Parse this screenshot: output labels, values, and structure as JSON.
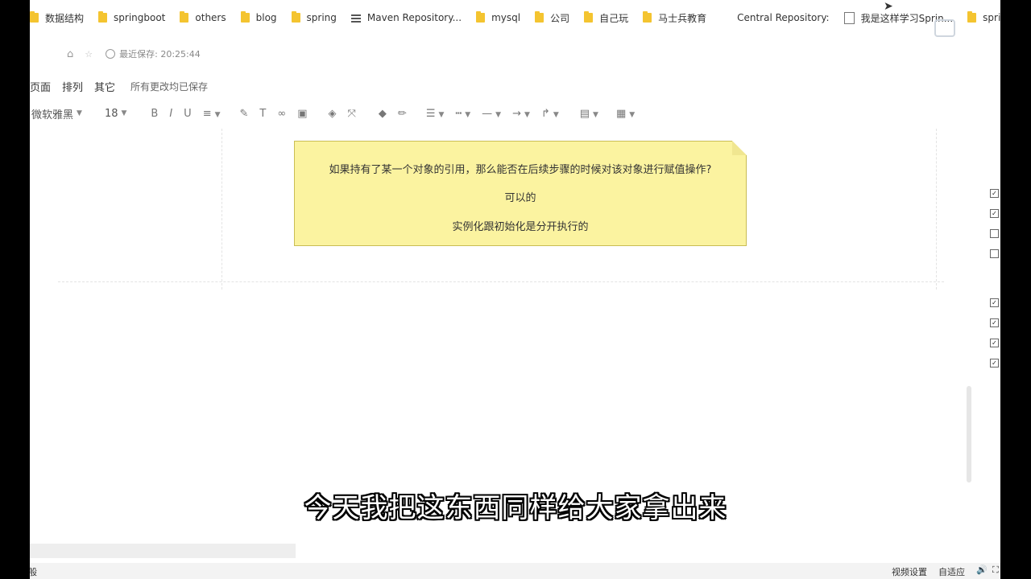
{
  "bookmarks": [
    {
      "label": "数据结构",
      "icon": "folder-icon"
    },
    {
      "label": "springboot",
      "icon": "folder-icon"
    },
    {
      "label": "others",
      "icon": "folder-icon"
    },
    {
      "label": "blog",
      "icon": "folder-icon"
    },
    {
      "label": "spring",
      "icon": "folder-icon"
    },
    {
      "label": "Maven Repository...",
      "icon": "maven-icon"
    },
    {
      "label": "mysql",
      "icon": "folder-icon"
    },
    {
      "label": "公司",
      "icon": "folder-icon"
    },
    {
      "label": "自己玩",
      "icon": "folder-icon"
    },
    {
      "label": "马士兵教育",
      "icon": "folder-icon"
    },
    {
      "label": "Central Repository:",
      "icon": ""
    },
    {
      "label": "我是这样学习Sprin...",
      "icon": "page-icon"
    },
    {
      "label": "sprin",
      "icon": "folder-icon"
    }
  ],
  "header": {
    "saved_time": "最近保存: 20:25:44"
  },
  "menu": {
    "items": [
      "页面",
      "排列",
      "其它"
    ],
    "status": "所有更改均已保存"
  },
  "toolbar": {
    "font": "微软雅黑",
    "size": "18"
  },
  "note": {
    "line1": "如果持有了某一个对象的引用，那么能否在后续步骤的时候对该对象进行赋值操作?",
    "line2": "可以的",
    "line3": "实例化跟初始化是分开执行的"
  },
  "subtitle": "今天我把这东西同样给大家拿出来",
  "statusbar": {
    "network": "网络一般",
    "video_settings": "视频设置",
    "fit": "自适应"
  },
  "colors": {
    "note_bg": "#fbf3a0",
    "note_border": "#c9bd54"
  }
}
